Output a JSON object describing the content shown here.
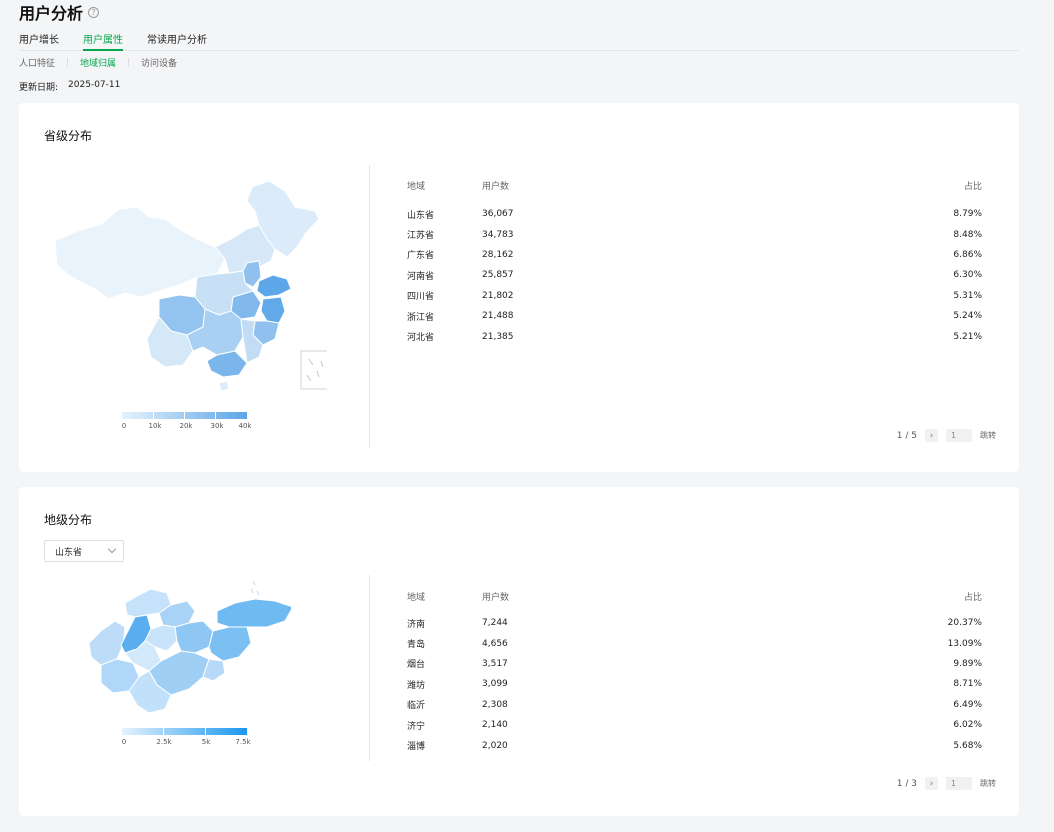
{
  "page": {
    "title": "用户分析",
    "help_icon": "?"
  },
  "tabs": [
    {
      "label": "用户增长",
      "active": false
    },
    {
      "label": "用户属性",
      "active": true
    },
    {
      "label": "常读用户分析",
      "active": false
    }
  ],
  "subtabs": [
    {
      "label": "人口特征",
      "active": false
    },
    {
      "label": "地域归属",
      "active": true
    },
    {
      "label": "访问设备",
      "active": false
    }
  ],
  "update": {
    "label": "更新日期:",
    "date": "2025-07-11"
  },
  "province": {
    "title": "省级分布",
    "legend": {
      "labels": [
        "0",
        "10k",
        "20k",
        "30k",
        "40k"
      ],
      "colors": [
        "#e6f2fc",
        "#5da6e8"
      ]
    },
    "headers": {
      "region": "地域",
      "users": "用户数",
      "share": "占比"
    },
    "rows": [
      {
        "region": "山东省",
        "users": "36,067",
        "share": "8.79%"
      },
      {
        "region": "江苏省",
        "users": "34,783",
        "share": "8.48%"
      },
      {
        "region": "广东省",
        "users": "28,162",
        "share": "6.86%"
      },
      {
        "region": "河南省",
        "users": "25,857",
        "share": "6.30%"
      },
      {
        "region": "四川省",
        "users": "21,802",
        "share": "5.31%"
      },
      {
        "region": "浙江省",
        "users": "21,488",
        "share": "5.24%"
      },
      {
        "region": "河北省",
        "users": "21,385",
        "share": "5.21%"
      }
    ],
    "pager": {
      "text": "1 / 5",
      "next": "›",
      "input": "1",
      "jump": "跳转"
    }
  },
  "city": {
    "title": "地级分布",
    "select": {
      "value": "山东省"
    },
    "legend": {
      "labels": [
        "0",
        "2.5k",
        "5k",
        "7.5k"
      ],
      "colors": [
        "#e4f2fd",
        "#1a97ef"
      ]
    },
    "headers": {
      "region": "地域",
      "users": "用户数",
      "share": "占比"
    },
    "rows": [
      {
        "region": "济南",
        "users": "7,244",
        "share": "20.37%"
      },
      {
        "region": "青岛",
        "users": "4,656",
        "share": "13.09%"
      },
      {
        "region": "烟台",
        "users": "3,517",
        "share": "9.89%"
      },
      {
        "region": "潍坊",
        "users": "3,099",
        "share": "8.71%"
      },
      {
        "region": "临沂",
        "users": "2,308",
        "share": "6.49%"
      },
      {
        "region": "济宁",
        "users": "2,140",
        "share": "6.02%"
      },
      {
        "region": "淄博",
        "users": "2,020",
        "share": "5.68%"
      }
    ],
    "pager": {
      "text": "1 / 3",
      "next": "›",
      "input": "1",
      "jump": "跳转"
    }
  }
}
